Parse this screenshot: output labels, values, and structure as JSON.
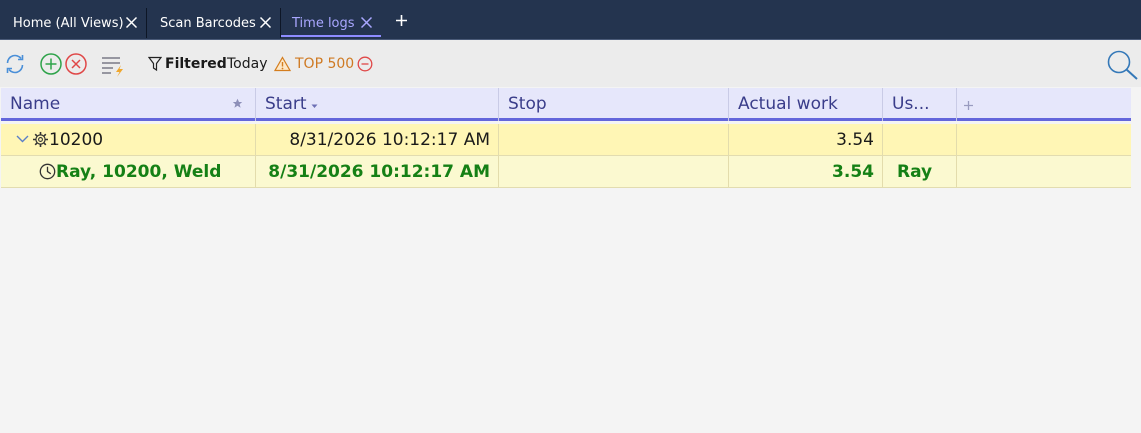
{
  "tabs": [
    {
      "label": "Home (All Views)"
    },
    {
      "label": "Scan Barcodes"
    },
    {
      "label": "Time logs"
    }
  ],
  "toolbar": {
    "filtered_label": "Filtered",
    "filter_value": "Today",
    "top_label": "TOP 500"
  },
  "columns": [
    {
      "label": "Name"
    },
    {
      "label": "Start"
    },
    {
      "label": "Stop"
    },
    {
      "label": "Actual work"
    },
    {
      "label": "Us..."
    }
  ],
  "rows": [
    {
      "name": "10200",
      "start": "8/31/2026 10:12:17 AM",
      "stop": "",
      "actual": "3.54",
      "user": ""
    },
    {
      "name": "Ray, 10200, Weld",
      "start": "8/31/2026 10:12:17 AM",
      "stop": "",
      "actual": "3.54",
      "user": "Ray"
    }
  ],
  "colors": {
    "accent": "#6366db",
    "group_row": "#fff6b5",
    "child_row": "#fbf9d0",
    "child_text": "#158015",
    "tab_bar": "#24344f"
  }
}
